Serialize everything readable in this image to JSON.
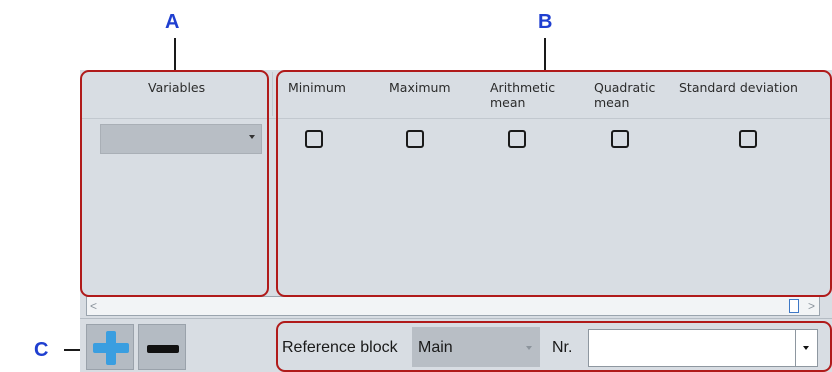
{
  "callouts": {
    "a": "A",
    "b": "B",
    "c": "C"
  },
  "columns": {
    "variables": "Variables",
    "minimum": "Minimum",
    "maximum": "Maximum",
    "arithmetic_mean_1": "Arithmetic",
    "arithmetic_mean_2": "mean",
    "quadratic_mean_1": "Quadratic",
    "quadratic_mean_2": "mean",
    "standard_deviation": "Standard deviation"
  },
  "row": {
    "variable_value": "",
    "checks": {
      "minimum": false,
      "maximum": false,
      "arithmetic_mean": false,
      "quadratic_mean": false,
      "standard_deviation": false
    }
  },
  "scrollbar": {
    "left_arrow": "<",
    "right_arrow": ">"
  },
  "toolbar": {
    "reference_block_label": "Reference block",
    "reference_block_value": "Main",
    "nr_label": "Nr.",
    "nr_value": ""
  },
  "colors": {
    "callout_border": "#b01a1a",
    "callout_letter": "#1f3fd0",
    "panel_bg": "#d8dde3",
    "plus_icon": "#3a9ee0"
  },
  "icons": {
    "add": "plus-icon",
    "remove": "minus-icon"
  }
}
